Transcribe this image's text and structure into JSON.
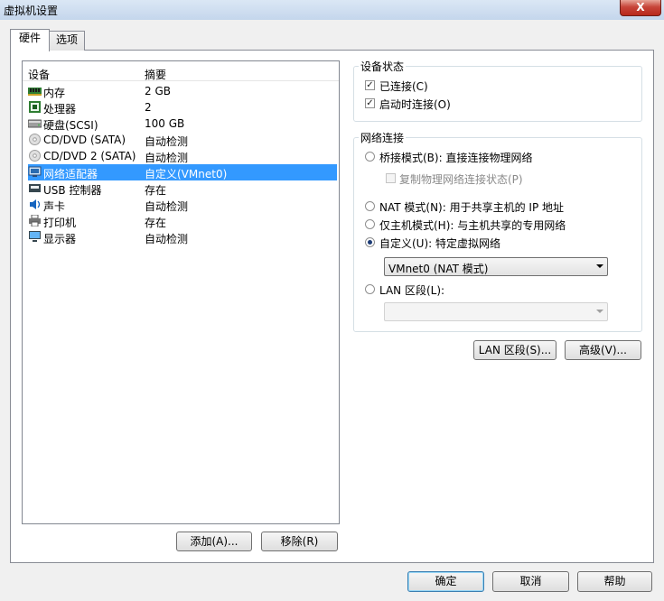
{
  "window": {
    "title": "虚拟机设置",
    "close_glyph": "X"
  },
  "tabs": [
    {
      "label": "硬件",
      "active": true
    },
    {
      "label": "选项",
      "active": false
    }
  ],
  "device_list": {
    "columns": {
      "device": "设备",
      "summary": "摘要"
    },
    "rows": [
      {
        "name": "内存",
        "summary": "2 GB",
        "icon": "memory-icon",
        "selected": false
      },
      {
        "name": "处理器",
        "summary": "2",
        "icon": "processor-icon",
        "selected": false
      },
      {
        "name": "硬盘(SCSI)",
        "summary": "100 GB",
        "icon": "hard-disk-icon",
        "selected": false
      },
      {
        "name": "CD/DVD (SATA)",
        "summary": "自动检测",
        "icon": "cd-dvd-icon",
        "selected": false
      },
      {
        "name": "CD/DVD 2 (SATA)",
        "summary": "自动检测",
        "icon": "cd-dvd-icon",
        "selected": false
      },
      {
        "name": "网络适配器",
        "summary": "自定义(VMnet0)",
        "icon": "network-adapter-icon",
        "selected": true
      },
      {
        "name": "USB 控制器",
        "summary": "存在",
        "icon": "usb-icon",
        "selected": false
      },
      {
        "name": "声卡",
        "summary": "自动检测",
        "icon": "sound-card-icon",
        "selected": false
      },
      {
        "name": "打印机",
        "summary": "存在",
        "icon": "printer-icon",
        "selected": false
      },
      {
        "name": "显示器",
        "summary": "自动检测",
        "icon": "display-icon",
        "selected": false
      }
    ]
  },
  "list_buttons": {
    "add": "添加(A)...",
    "remove": "移除(R)"
  },
  "device_status": {
    "title": "设备状态",
    "connected": {
      "label": "已连接(C)",
      "checked": true
    },
    "connect_at_power_on": {
      "label": "启动时连接(O)",
      "checked": true
    }
  },
  "network_connection": {
    "title": "网络连接",
    "bridged": {
      "label": "桥接模式(B): 直接连接物理网络",
      "selected": false
    },
    "replicate_state": {
      "label": "复制物理网络连接状态(P)",
      "checked": false,
      "enabled": false
    },
    "nat": {
      "label": "NAT 模式(N): 用于共享主机的 IP 地址",
      "selected": false
    },
    "host_only": {
      "label": "仅主机模式(H): 与主机共享的专用网络",
      "selected": false
    },
    "custom": {
      "label": "自定义(U): 特定虚拟网络",
      "selected": true
    },
    "custom_select": {
      "value": "VMnet0 (NAT 模式)"
    },
    "lan_segment": {
      "label": "LAN 区段(L):",
      "selected": false
    },
    "lan_select": {
      "value": "",
      "enabled": false
    }
  },
  "network_buttons": {
    "lan_segments": "LAN 区段(S)...",
    "advanced": "高级(V)..."
  },
  "footer_buttons": {
    "ok": "确定",
    "cancel": "取消",
    "help": "帮助"
  },
  "colors": {
    "selection": "#3399ff",
    "titlebar": "#c4d6ec",
    "close": "#c7453a"
  }
}
